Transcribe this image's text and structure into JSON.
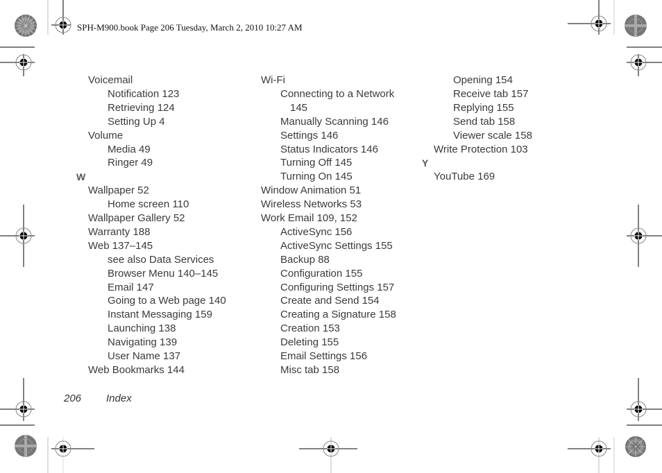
{
  "header": {
    "text": "SPH-M900.book  Page 206  Tuesday, March 2, 2010  10:27 AM"
  },
  "columns": [
    {
      "items": [
        {
          "level": 1,
          "text": "Voicemail"
        },
        {
          "level": 2,
          "text": "Notification 123"
        },
        {
          "level": 2,
          "text": "Retrieving 124"
        },
        {
          "level": 2,
          "text": "Setting Up 4"
        },
        {
          "level": 1,
          "text": "Volume"
        },
        {
          "level": 2,
          "text": "Media 49"
        },
        {
          "level": 2,
          "text": "Ringer 49"
        },
        {
          "level": 0,
          "text": "W"
        },
        {
          "level": 1,
          "text": "Wallpaper 52"
        },
        {
          "level": 2,
          "text": "Home screen 110"
        },
        {
          "level": 1,
          "text": "Wallpaper Gallery 52"
        },
        {
          "level": 1,
          "text": "Warranty 188"
        },
        {
          "level": 1,
          "text": "Web 137–145"
        },
        {
          "level": 2,
          "text": "see also Data Services"
        },
        {
          "level": 2,
          "text": "Browser Menu 140–145"
        },
        {
          "level": 2,
          "text": "Email 147"
        },
        {
          "level": 2,
          "text": "Going to a Web page 140"
        },
        {
          "level": 2,
          "text": "Instant Messaging 159"
        },
        {
          "level": 2,
          "text": "Launching 138"
        },
        {
          "level": 2,
          "text": "Navigating 139"
        },
        {
          "level": 2,
          "text": "User Name 137"
        },
        {
          "level": 1,
          "text": "Web Bookmarks 144"
        }
      ]
    },
    {
      "items": [
        {
          "level": 1,
          "text": "Wi-Fi"
        },
        {
          "level": 2,
          "text": "Connecting to a Network"
        },
        {
          "level": 3,
          "text": "145"
        },
        {
          "level": 2,
          "text": "Manually Scanning 146"
        },
        {
          "level": 2,
          "text": "Settings 146"
        },
        {
          "level": 2,
          "text": "Status Indicators 146"
        },
        {
          "level": 2,
          "text": "Turning Off 145"
        },
        {
          "level": 2,
          "text": "Turning On 145"
        },
        {
          "level": 1,
          "text": "Window Animation 51"
        },
        {
          "level": 1,
          "text": "Wireless Networks 53"
        },
        {
          "level": 1,
          "text": "Work Email 109, 152"
        },
        {
          "level": 2,
          "text": "ActiveSync 156"
        },
        {
          "level": 2,
          "text": "ActiveSync Settings 155"
        },
        {
          "level": 2,
          "text": "Backup 88"
        },
        {
          "level": 2,
          "text": "Configuration 155"
        },
        {
          "level": 2,
          "text": "Configuring Settings 157"
        },
        {
          "level": 2,
          "text": "Create and Send 154"
        },
        {
          "level": 2,
          "text": "Creating a Signature 158"
        },
        {
          "level": 2,
          "text": "Creation 153"
        },
        {
          "level": 2,
          "text": "Deleting 155"
        },
        {
          "level": 2,
          "text": "Email Settings 156"
        },
        {
          "level": 2,
          "text": "Misc tab 158"
        }
      ]
    },
    {
      "items": [
        {
          "level": 2,
          "text": "Opening 154"
        },
        {
          "level": 2,
          "text": "Receive tab 157"
        },
        {
          "level": 2,
          "text": "Replying 155"
        },
        {
          "level": 2,
          "text": "Send tab 158"
        },
        {
          "level": 2,
          "text": "Viewer scale 158"
        },
        {
          "level": 1,
          "text": "Write Protection 103"
        },
        {
          "level": 0,
          "text": "Y"
        },
        {
          "level": 1,
          "text": "YouTube 169"
        }
      ]
    }
  ],
  "footer": {
    "page_number": "206",
    "section": "Index"
  }
}
